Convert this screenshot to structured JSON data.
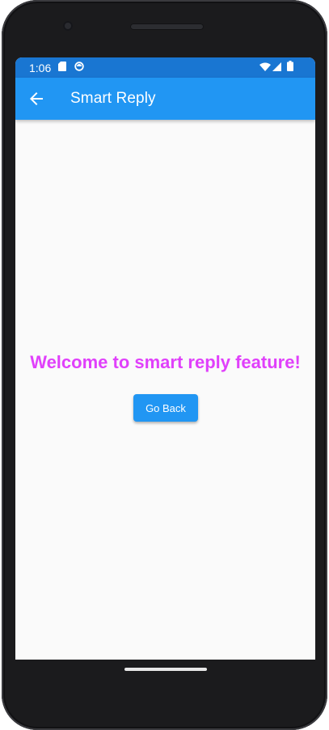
{
  "status_bar": {
    "time": "1:06",
    "icons_left": [
      "sd-card-icon",
      "sync-icon"
    ],
    "icons_right": [
      "wifi-icon",
      "cellular-signal-icon",
      "battery-icon"
    ]
  },
  "app_bar": {
    "title": "Smart Reply",
    "back_icon": "arrow-back-icon"
  },
  "main": {
    "welcome_text": "Welcome to smart reply feature!",
    "go_back_label": "Go Back"
  },
  "colors": {
    "status_bar": "#1976d2",
    "app_bar": "#2196f3",
    "welcome_text": "#e040fb",
    "button": "#2196f3",
    "background": "#fafafa"
  }
}
